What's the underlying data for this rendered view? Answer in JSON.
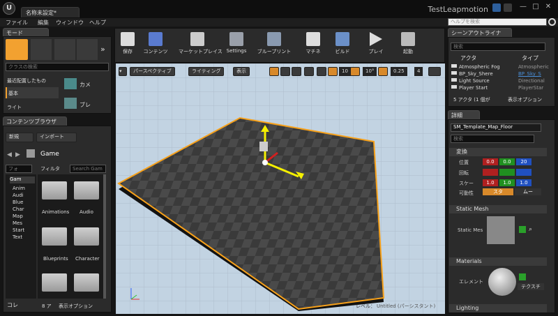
{
  "app": {
    "tab_title": "名称未設定*",
    "window_title": "TestLeapmotion",
    "logo": "U"
  },
  "window_buttons": [
    "—",
    "□",
    "✕"
  ],
  "menu": {
    "items": [
      "ファイル",
      "編集",
      "ウィンドウ",
      "ヘルプ"
    ],
    "help_search_placeholder": "ヘルプを検索"
  },
  "modes": {
    "tab": "モード",
    "class_search_placeholder": "クラスの検索",
    "categories": [
      "最近配置したもの",
      "基本",
      "ライト"
    ],
    "items": [
      "カメ",
      "ブレ"
    ]
  },
  "toolbar": {
    "buttons": [
      "保存",
      "コンテンツ",
      "マーケットプレイス",
      "Settings",
      "ブループリント",
      "マチネ",
      "ビルド",
      "プレイ",
      "起動"
    ]
  },
  "viewport": {
    "perspective": "パースペクティブ",
    "lighting": "ライティング",
    "show": "表示",
    "grid_snap": "10",
    "rot_snap": "10°",
    "scale_snap": "0.25",
    "camera_speed": "4",
    "level_label": "レベル：",
    "level_name": "Untitled (パーシスタント)"
  },
  "content_browser": {
    "tab": "コンテンツブラウザ",
    "new_button": "新規",
    "import_button": "インポート",
    "path": "Game",
    "folder_search_placeholder": "フォ",
    "filter_button": "フィルタ",
    "search_placeholder": "Search Gam",
    "tree": [
      "Gam",
      "Anim",
      "Audi",
      "Blue",
      "Char",
      "Map",
      "Mes",
      "Start",
      "Text"
    ],
    "assets": [
      "Animations",
      "Audio",
      "Blueprints",
      "Character",
      "",
      ""
    ],
    "collections": "コレ",
    "count": "8 ア",
    "view_options": "表示オプション"
  },
  "outliner": {
    "tab": "シーンアウトライナ",
    "search_placeholder": "検索",
    "col_actor": "アクタ",
    "col_type": "タイプ",
    "rows": [
      {
        "name": "Atmospheric Fog",
        "type": "Atmospheric"
      },
      {
        "name": "BP_Sky_Shere",
        "type": "BP_Sky_S"
      },
      {
        "name": "Light Source",
        "type": "Directional"
      },
      {
        "name": "Player Start",
        "type": "PlayerStar"
      }
    ],
    "count": "5 アクタ (1 個が",
    "view_options": "表示オプション"
  },
  "details": {
    "tab": "詳細",
    "object_name": "SM_Template_Map_Floor",
    "search_placeholder": "検索",
    "transform_header": "変換",
    "location_label": "位置",
    "rotation_label": "回転",
    "scale_label": "スケー",
    "mobility_label": "可動性",
    "location": {
      "x": "0.0",
      "y": "0.0",
      "z": "20"
    },
    "scale": {
      "x": "1.0",
      "y": "1.0",
      "z": "1.0"
    },
    "mobility_static": "スタ",
    "mobility_movable": "ムー",
    "static_mesh_header": "Static Mesh",
    "static_mesh_label": "Static Mes",
    "materials_header": "Materials",
    "element_label": "エレメント",
    "texture_button": "テクスチ",
    "lighting_header": "Lighting"
  },
  "colors": {
    "selection": "#f7a11a",
    "accent_blue": "#4a8fd8",
    "gizmo_yellow": "#f5f000"
  }
}
